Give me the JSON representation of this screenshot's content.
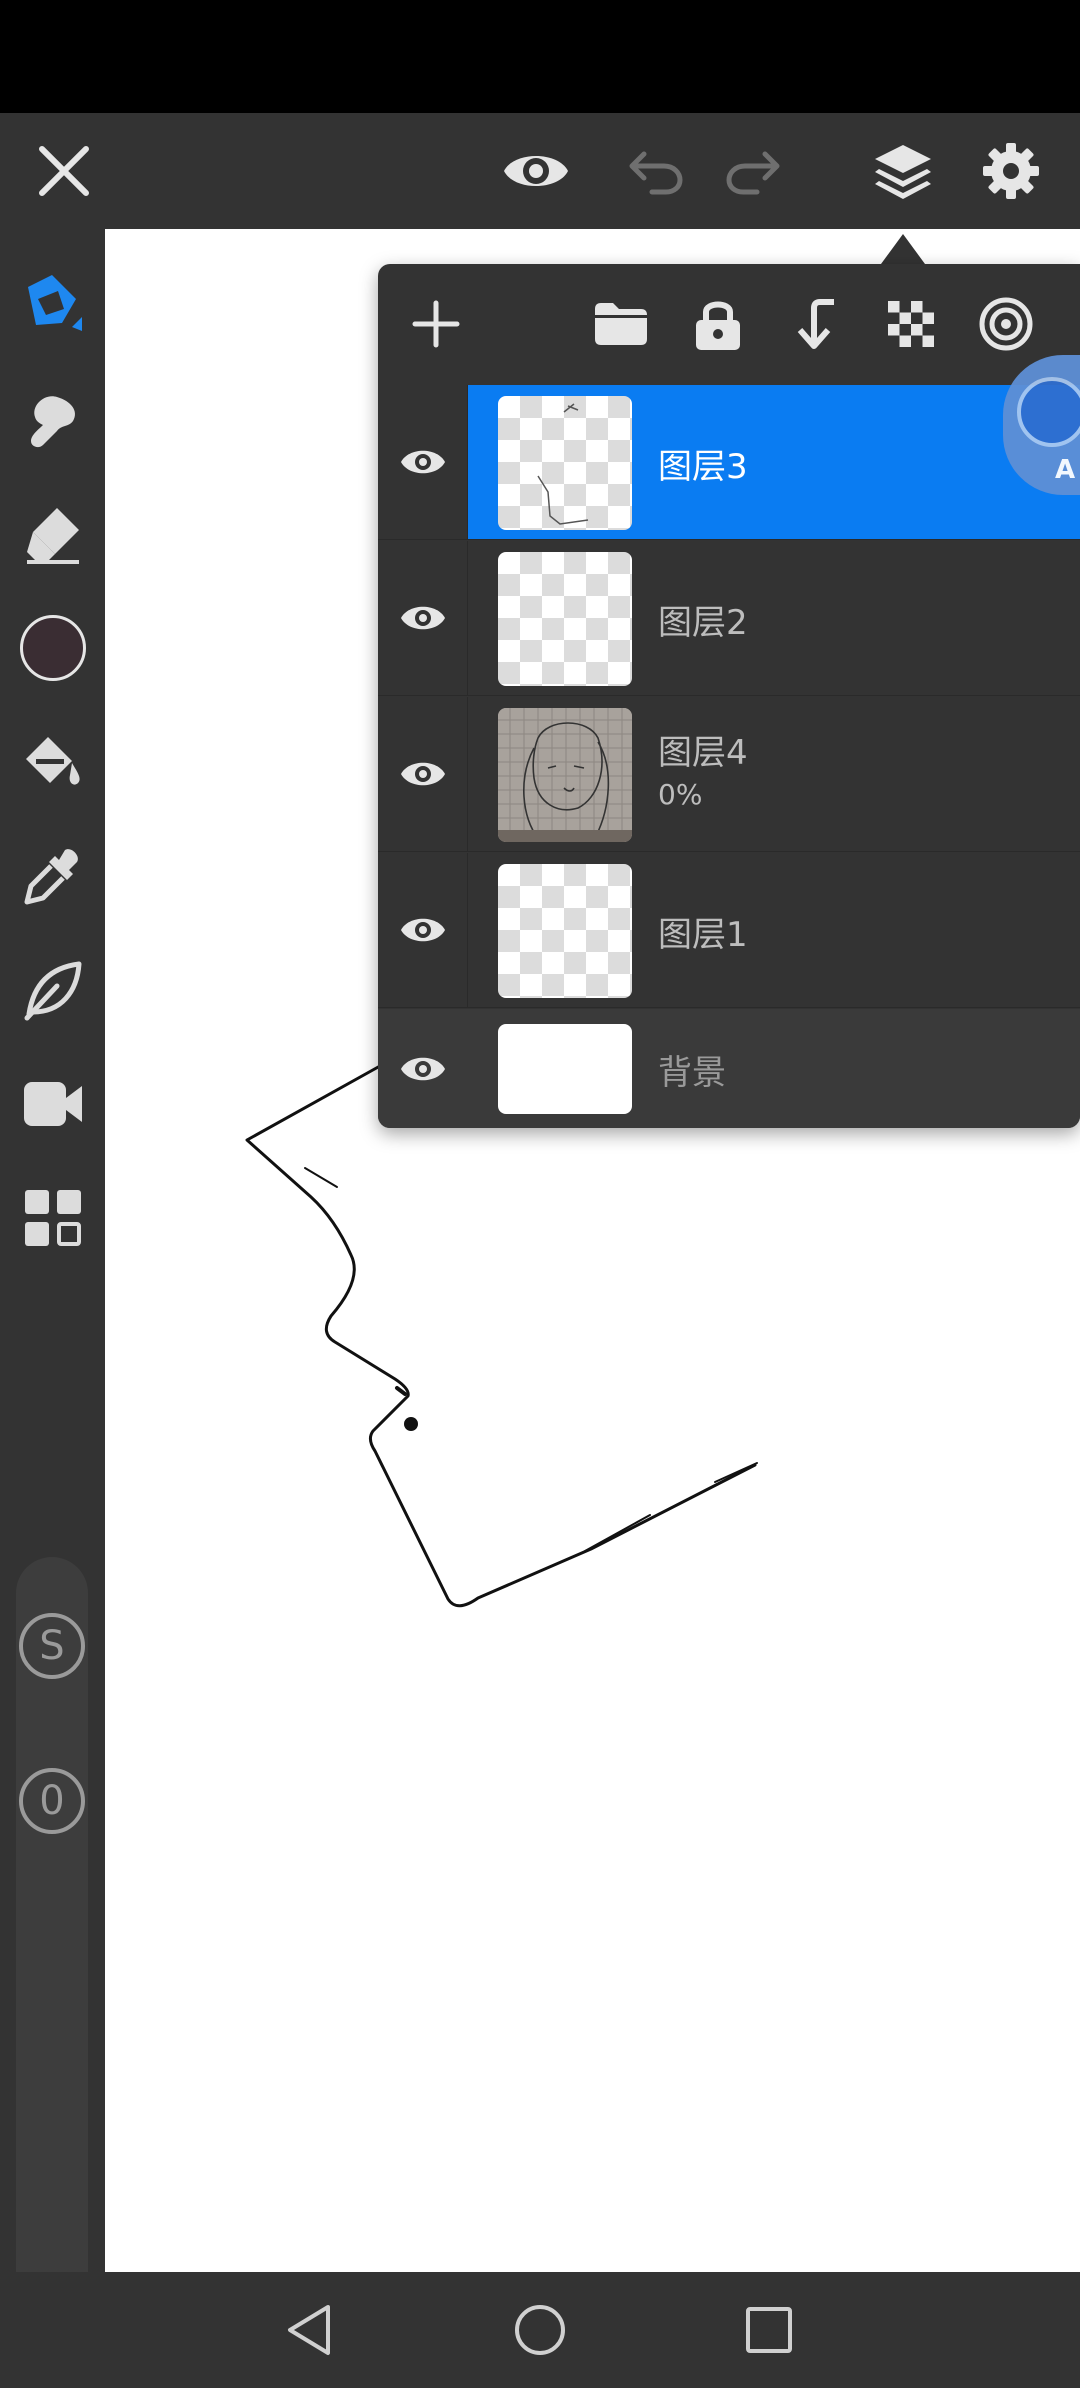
{
  "layers": [
    {
      "name": "图层3",
      "subtitle": "",
      "selected": true
    },
    {
      "name": "图层2",
      "subtitle": "",
      "selected": false
    },
    {
      "name": "图层4",
      "subtitle": "0%",
      "selected": false
    },
    {
      "name": "图层1",
      "subtitle": "",
      "selected": false
    },
    {
      "name": "背景",
      "subtitle": "",
      "selected": false
    }
  ],
  "sidebar": {
    "stabilizer_label": "S",
    "opacity_label": "0",
    "current_color": "#3a2d33"
  },
  "floating_badge": {
    "label": "A"
  },
  "colors": {
    "accent": "#0a7cf2",
    "panel": "#333333",
    "canvas": "#ffffff"
  },
  "icons": {
    "topbar": [
      "close-icon",
      "preview-eye-icon",
      "undo-icon",
      "redo-icon",
      "layers-icon",
      "settings-gear-icon"
    ],
    "tools": [
      "pen-icon",
      "smudge-icon",
      "eraser-icon",
      "color-swatch",
      "fill-bucket-icon",
      "eyedropper-icon",
      "leaf-icon",
      "video-camera-icon",
      "grid-apps-icon"
    ],
    "layer_toolbar": [
      "add-layer-icon",
      "folder-icon",
      "lock-icon",
      "merge-down-icon",
      "transparency-checker-icon",
      "blend-mode-icon"
    ],
    "navbar": [
      "back-icon",
      "home-icon",
      "recents-icon"
    ]
  }
}
